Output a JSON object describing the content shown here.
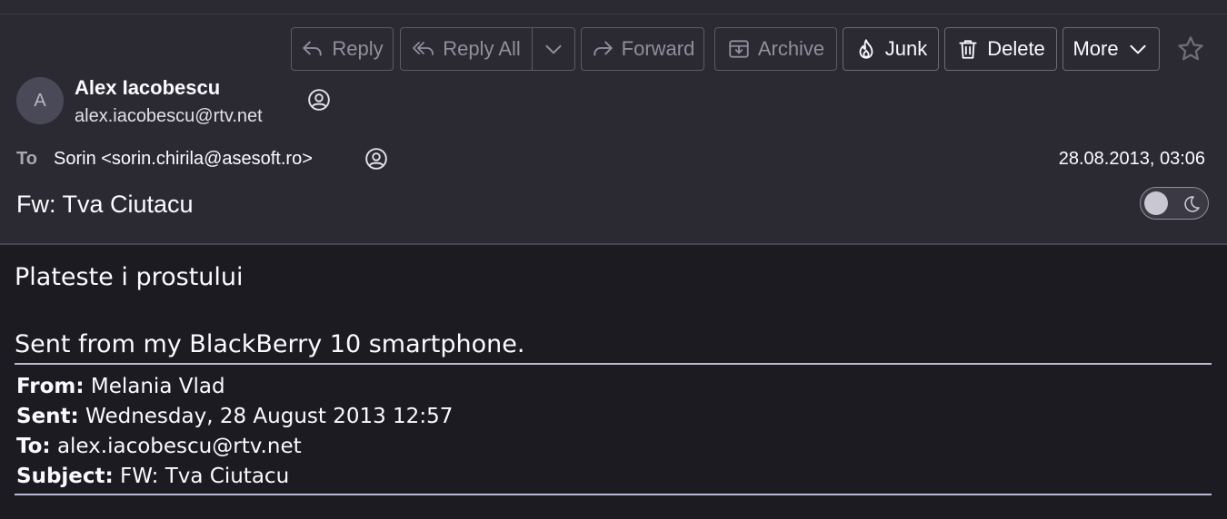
{
  "toolbar": {
    "reply": "Reply",
    "reply_all": "Reply All",
    "forward": "Forward",
    "archive": "Archive",
    "junk": "Junk",
    "delete": "Delete",
    "more": "More"
  },
  "sender": {
    "avatar_initial": "A",
    "name": "Alex Iacobescu",
    "email": "alex.iacobescu@rtv.net"
  },
  "recipient": {
    "label": "To",
    "value": "Sorin <sorin.chirila@asesoft.ro>"
  },
  "date": "28.08.2013, 03:06",
  "subject": "Fw: Tva Ciutacu",
  "message": {
    "line1": "Plateste i prostului",
    "signature": "Sent from my BlackBerry 10 smartphone."
  },
  "forwarded": {
    "from_label": "From:",
    "from_value": " Melania Vlad",
    "sent_label": "Sent:",
    "sent_value": " Wednesday, 28 August 2013 12:57",
    "to_label": "To:",
    "to_value": " alex.iacobescu@rtv.net",
    "subject_label": "Subject:",
    "subject_value": " FW: Tva Ciutacu"
  },
  "icons": {
    "reply": "reply-icon",
    "reply_all": "reply-all-icon",
    "forward": "forward-icon",
    "archive": "archive-icon",
    "junk": "flame-icon",
    "delete": "trash-icon",
    "more": "chevron-down-icon",
    "star": "star-icon",
    "contact": "contact-icon",
    "theme": "moon-icon"
  },
  "colors": {
    "header_bg": "#2b2a33",
    "body_bg": "#1c1b22",
    "text": "#fbfbfe",
    "disabled_text": "#8f8f9d",
    "rule": "#b9bcd4"
  }
}
